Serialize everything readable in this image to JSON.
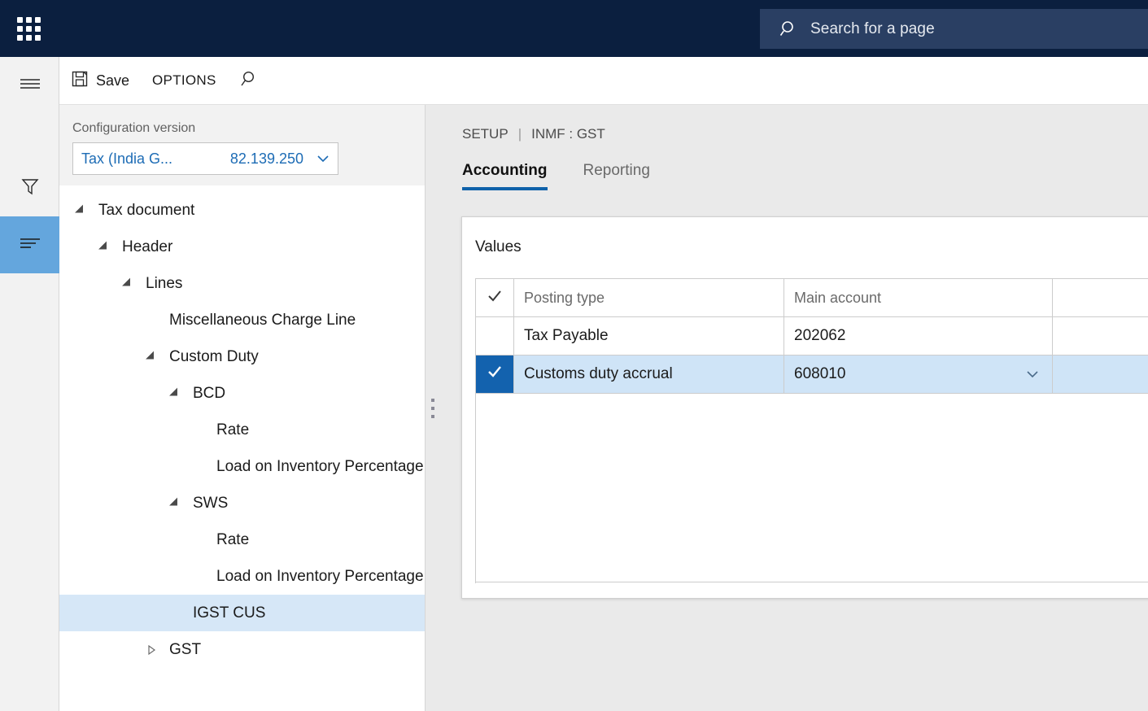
{
  "topbar": {
    "waffle_icon": "app-launcher-grid-icon",
    "search": {
      "icon": "search-icon",
      "placeholder": "Search for a page",
      "value": ""
    }
  },
  "action_pane": {
    "save_label": "Save",
    "save_icon": "save-floppy-icon",
    "options_label": "OPTIONS",
    "search_icon": "search-icon"
  },
  "rail": {
    "items": [
      {
        "name": "navigation-menu",
        "icon": "hamburger-icon",
        "active": false
      },
      {
        "name": "filter",
        "icon": "funnel-icon",
        "active": false
      },
      {
        "name": "outline",
        "icon": "list-outline-icon",
        "active": true
      }
    ]
  },
  "tree_panel": {
    "config_label": "Configuration version",
    "config_name": "Tax (India G...",
    "config_version": "82.139.250",
    "chevron_icon": "chevron-down-icon",
    "nodes": [
      {
        "label": "Tax document",
        "depth": 0,
        "state": "expanded",
        "selected": false
      },
      {
        "label": "Header",
        "depth": 1,
        "state": "expanded",
        "selected": false
      },
      {
        "label": "Lines",
        "depth": 2,
        "state": "expanded",
        "selected": false
      },
      {
        "label": "Miscellaneous Charge Line",
        "depth": 3,
        "state": "leaf",
        "selected": false
      },
      {
        "label": "Custom Duty",
        "depth": 3,
        "state": "expanded",
        "selected": false
      },
      {
        "label": "BCD",
        "depth": 4,
        "state": "expanded",
        "selected": false
      },
      {
        "label": "Rate",
        "depth": 5,
        "state": "leaf",
        "selected": false
      },
      {
        "label": "Load on Inventory Percentage",
        "depth": 5,
        "state": "leaf",
        "selected": false
      },
      {
        "label": "SWS",
        "depth": 4,
        "state": "expanded",
        "selected": false
      },
      {
        "label": "Rate",
        "depth": 5,
        "state": "leaf",
        "selected": false
      },
      {
        "label": "Load on Inventory Percentage",
        "depth": 5,
        "state": "leaf",
        "selected": false
      },
      {
        "label": "IGST CUS",
        "depth": 4,
        "state": "leaf",
        "selected": true
      },
      {
        "label": "GST",
        "depth": 3,
        "state": "collapsed",
        "selected": false
      }
    ]
  },
  "splitter": {
    "icon": "drag-handle-dots-icon"
  },
  "main": {
    "breadcrumb": {
      "root": "SETUP",
      "separator": "|",
      "current": "INMF : GST"
    },
    "tabs": [
      {
        "label": "Accounting",
        "active": true
      },
      {
        "label": "Reporting",
        "active": false
      }
    ],
    "card": {
      "title": "Values",
      "grid": {
        "columns": [
          "Posting type",
          "Main account"
        ],
        "header_check_icon": "checkmark-icon",
        "rows": [
          {
            "checked": false,
            "posting_type": "Tax Payable",
            "main_account": "202062",
            "selected": false
          },
          {
            "checked": true,
            "posting_type": "Customs duty accrual",
            "main_account": "608010",
            "selected": true
          }
        ],
        "lookup_icon": "chevron-down-icon"
      }
    }
  },
  "colors": {
    "topbar_bg": "#0b1f3f",
    "search_bg": "#2a3f63",
    "accent_blue": "#0f62aa",
    "selected_row_bg": "#cfe4f7",
    "selected_check_bg": "#1362ae",
    "rail_active_bg": "#64a6dd",
    "tree_selected_bg": "#d6e7f7",
    "link_blue": "#1d6cb5",
    "page_bg": "#eaeaea"
  }
}
